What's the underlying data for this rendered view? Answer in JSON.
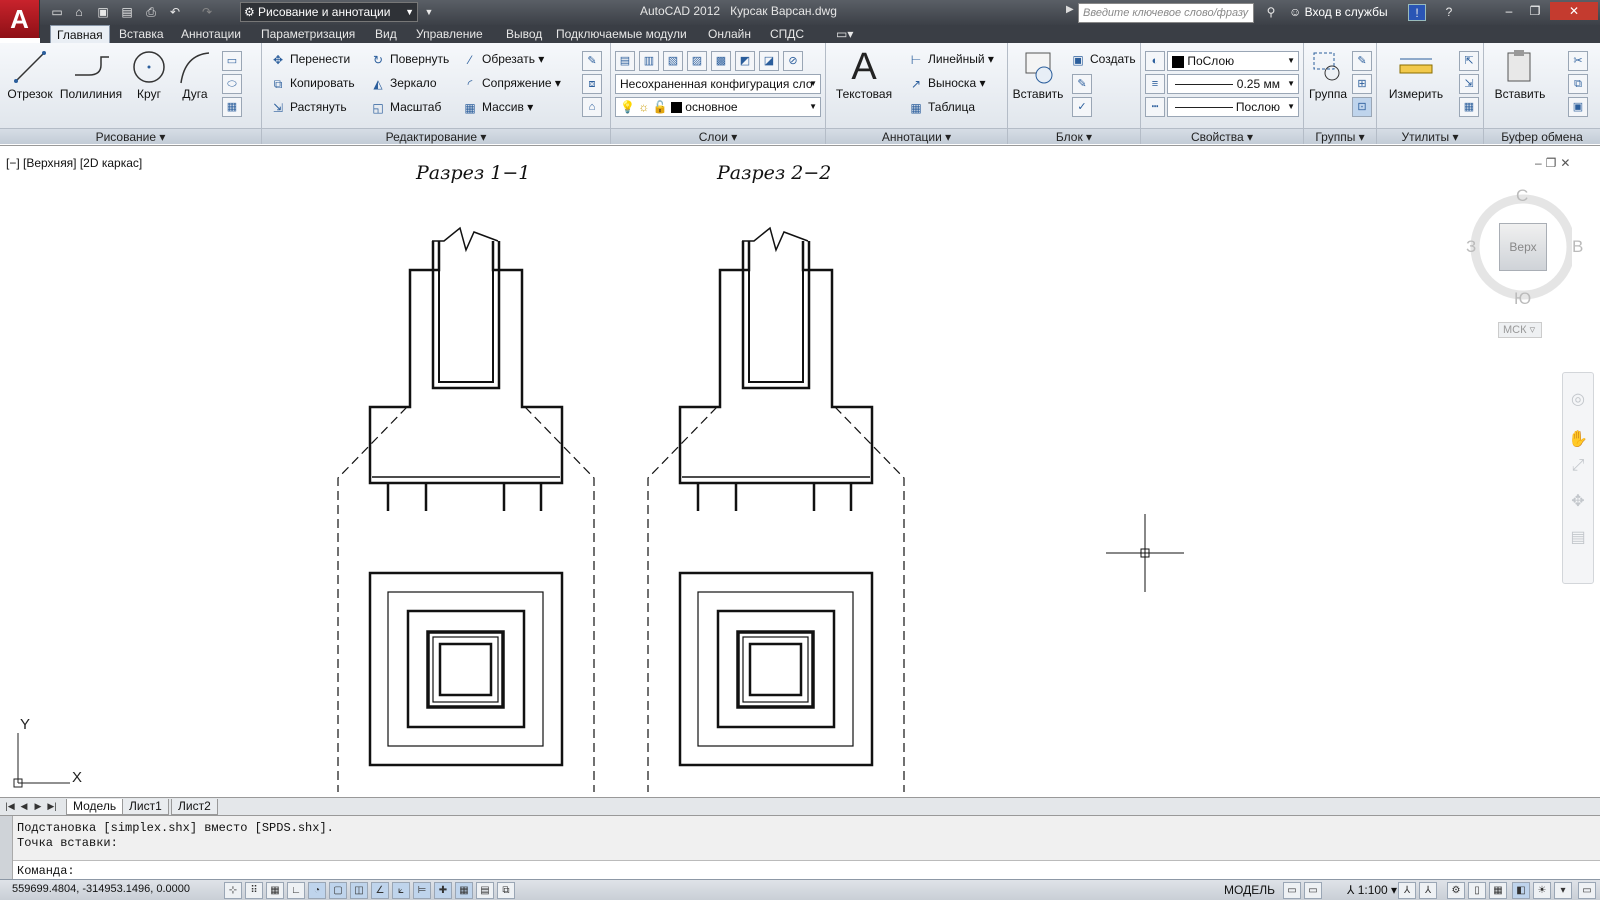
{
  "title": {
    "app": "AutoCAD 2012",
    "file": "Курсак Варсан.dwg"
  },
  "app_logo": "A",
  "workspace": "Рисование и аннотации",
  "search": {
    "placeholder": "Введите ключевое слово/фразу"
  },
  "signin": "Вход в службы",
  "ribbon_tabs": [
    "Главная",
    "Вставка",
    "Аннотации",
    "Параметризация",
    "Вид",
    "Управление",
    "Вывод",
    "Подключаемые модули",
    "Онлайн",
    "СПДС"
  ],
  "panels": {
    "draw": {
      "title": "Рисование",
      "line": "Отрезок",
      "polyline": "Полилиния",
      "circle": "Круг",
      "arc": "Дуга"
    },
    "modify": {
      "title": "Редактирование",
      "move": "Перенести",
      "rotate": "Повернуть",
      "trim": "Обрезать",
      "copy": "Копировать",
      "mirror": "Зеркало",
      "fillet": "Сопряжение",
      "stretch": "Растянуть",
      "scale": "Масштаб",
      "array": "Массив"
    },
    "layers": {
      "title": "Слои",
      "layer_state": "Несохраненная конфигурация сло",
      "current_layer": "основное"
    },
    "annotation": {
      "title": "Аннотации",
      "text": "Текстовая",
      "linear": "Линейный",
      "leader": "Выноска",
      "table": "Таблица"
    },
    "block": {
      "title": "Блок",
      "insert": "Вставить",
      "create": "Создать"
    },
    "properties": {
      "title": "Свойства",
      "color": "ПоСлою",
      "lineweight": "0.25 мм",
      "linetype": "Послою"
    },
    "groups": {
      "title": "Группы",
      "group": "Группа"
    },
    "utilities": {
      "title": "Утилиты",
      "measure": "Измерить"
    },
    "clipboard": {
      "title": "Буфер обмена",
      "paste": "Вставить"
    }
  },
  "viewport": {
    "label": "[−] [Верхняя] [2D каркас]"
  },
  "drawing": {
    "section1": "Разрез 1−1",
    "section2": "Разрез 2−2"
  },
  "viewcube": {
    "north": "С",
    "south": "Ю",
    "east": "В",
    "west": "З",
    "face": "Верх",
    "wcs": "МСК"
  },
  "ucs": {
    "x": "X",
    "y": "Y"
  },
  "layout_tabs": [
    "Модель",
    "Лист1",
    "Лист2"
  ],
  "command_history": [
    "Подстановка [simplex.shx] вместо [SPDS.shx].",
    "Точка вставки:"
  ],
  "command_prompt": "Команда:",
  "status": {
    "coords": "559699.4804, -314953.1496, 0.0000",
    "model": "МОДЕЛЬ",
    "scale": "1:100"
  },
  "colors": {
    "title_bg": "#3c4047",
    "ribbon_bg": "#dde3ea",
    "accent": "#2b5e9c",
    "app_red": "#c8232c"
  }
}
